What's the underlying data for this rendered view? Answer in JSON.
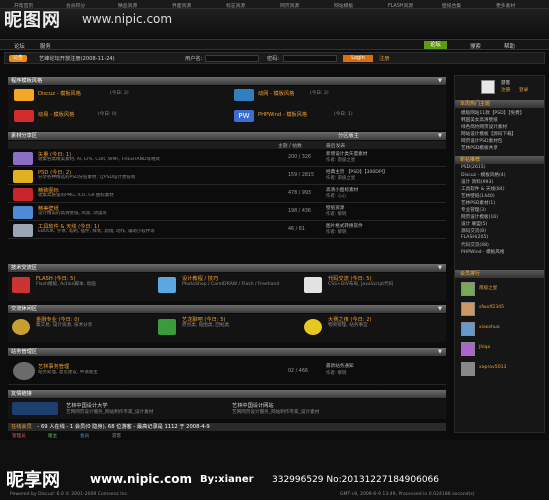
{
  "topnav": [
    "开帮首页",
    "会员积分",
    "精品资源",
    "界面资源",
    "标志资源",
    "网页资源",
    "网站模板",
    "FLASH资源",
    "壁纸合集",
    "更多素材"
  ],
  "logo": {
    "cn": "昵图网",
    "url": "www.nipic.com"
  },
  "mainnav": {
    "items": [
      "首页",
      "论坛",
      "搜索",
      "帮助"
    ],
    "active": "论坛",
    "left": [
      "论坛",
      "服务"
    ]
  },
  "crumb": {
    "pill": "公告",
    "text": "艺峰论坛开放注册(2008-11-24)",
    "user_label": "用户名:",
    "pass_label": "密码:",
    "login": "Login",
    "register": "注册"
  },
  "sections": [
    {
      "title": "程序模板风格",
      "label": "section-1"
    },
    {
      "title": "素材分享区",
      "label": "section-2",
      "cols": [
        "主题 / 帖数",
        "最后发表"
      ],
      "extra": "分区版主"
    },
    {
      "title": "技术交流区",
      "label": "section-3"
    },
    {
      "title": "交流休闲区",
      "label": "section-4"
    },
    {
      "title": "站务管理区",
      "label": "section-5"
    },
    {
      "title": "友情链接",
      "label": "section-6"
    }
  ],
  "program_cells": [
    {
      "title": "Discuz - 模板风格",
      "count": "(今日: 2)"
    },
    {
      "title": "动网 - 模板风格",
      "count": "(今日: 2)"
    },
    {
      "title": "动易 - 模板风格",
      "count": "(今日: 0)"
    },
    {
      "title": "PHPWind - 模板风格",
      "count": "(今日: 1)"
    }
  ],
  "forums": [
    {
      "title": "矢量 (今日: 1)",
      "desc": "收集各类精美素材, AI, EPS, CDR, WMF, FREEHAND等格式",
      "count": "200 / 326",
      "last1": "新增设计类矢量素材",
      "last2": "作者: 南极之星"
    },
    {
      "title": "PSD (今日: 2)",
      "desc": "分享各种精选的PSD分层素材, 让PSD设计更容易",
      "count": "159 / 2815",
      "last1": "经典主页 【PSD】【300DPI】",
      "last2": "作者: 南极之星"
    },
    {
      "title": "精致图标",
      "desc": "收集高质量的PNG, ICO, GIF图标素材",
      "count": "478 / 993",
      "last1": "高清小图标素材",
      "last2": "作者: 心心"
    },
    {
      "title": "精美壁纸",
      "desc": "设计精美的高清壁纸, 风景, 动漫等",
      "count": "198 / 436",
      "last1": "壁纸资源",
      "last2": "作者: 黎明"
    },
    {
      "title": "工具软件 & 天线 (今日: 1)",
      "desc": "EBOOK, 字体, 笔刷, 插件, 样式, 滤镜, 动作, 辅助小软件等",
      "count": "46 / 81",
      "last1": "图片格式转换软件",
      "last2": "作者: 黎明"
    }
  ],
  "tech_cells": [
    {
      "title": "FLASH (今日: 5)",
      "desc": "Flash模板, Action脚本, 动画"
    },
    {
      "title": "设计教程 / 技巧",
      "desc": "PhotoShop / CorelDRAW / Flash / Freehand"
    },
    {
      "title": "代码交流 (今日: 5)",
      "desc": "CSS+DIV布局, JavaScript代码"
    }
  ],
  "leisure_cells": [
    {
      "title": "金融专业 (今日: 0)",
      "desc": "集交易, 设计资源, 技术分享"
    },
    {
      "title": "艺龙聊吧 (今日: 5)",
      "desc": "原创类, 贴图类, 回帖类"
    },
    {
      "title": "大赛之夜 (今日: 2)",
      "desc": "物资管理, 站务事宜"
    }
  ],
  "admin": {
    "title": "艺林事务管理",
    "desc": "站务处理, 意见建议, 申请版主",
    "count": "02 / 466",
    "last1": "最新站务通知",
    "last2": "作者: 黎明"
  },
  "links": {
    "items": [
      "艺林中国设计大学",
      "艺林中国设计网站",
      "艺网网页设计网"
    ],
    "mottos": [
      "艺网网页设计服务_网站制作专家_设计素材",
      "艺网网页设计服务_网站制作专家_设计素材"
    ]
  },
  "online": {
    "title": "在线会员",
    "text": "- 69 人在线 - 1 会员(0 隐身), 68 位游客 - 最高记录是 1112 于 2008-4-9",
    "legend": [
      "管理员",
      "版主",
      "会员",
      "游客"
    ]
  },
  "footer": {
    "copy": "Powered by Discuz! 6.0 © 2001-2009 Comsenz Inc.",
    "gmt": "GMT+8, 2009-6-9 13:49, Processed in 0.024186 second(s)"
  },
  "sidebar": {
    "user": "游客",
    "links": [
      "注册",
      "登录"
    ],
    "hot_title": "本周热门主题",
    "hot": [
      "模板网站11款【PSD】【免费】",
      "韩国美女高清壁纸",
      "绿色简约网页设计素材",
      "网站设计模板【源码下载】",
      "网页设计PSD素材包",
      "艺林PSD模板共享"
    ],
    "new_title": "新帖推荐",
    "new": [
      "PSD(2615)",
      "Discuz - 模板风格(4)",
      "设计 资料(993)",
      "工具软件 & 天线(84)",
      "艺林壁纸(1440)",
      "艺林PSD素材(1)",
      "专业管理(3)",
      "网页设计模板(16)",
      "设计 联盟(5)",
      "源码交流(8)",
      "FLASH(205)",
      "代码交流(48)",
      "PHPWind - 模板风格"
    ],
    "rank_title": "会员排行",
    "ranks": [
      "南极之星",
      "sfwolf2345",
      "xiaoshuo",
      "Jhiqo",
      "xaprov5013"
    ]
  },
  "watermark": {
    "brand": "昵享网",
    "url": "www.nipic.com",
    "by": "By:xianer",
    "id": "332996529 No:20131227184906066"
  }
}
